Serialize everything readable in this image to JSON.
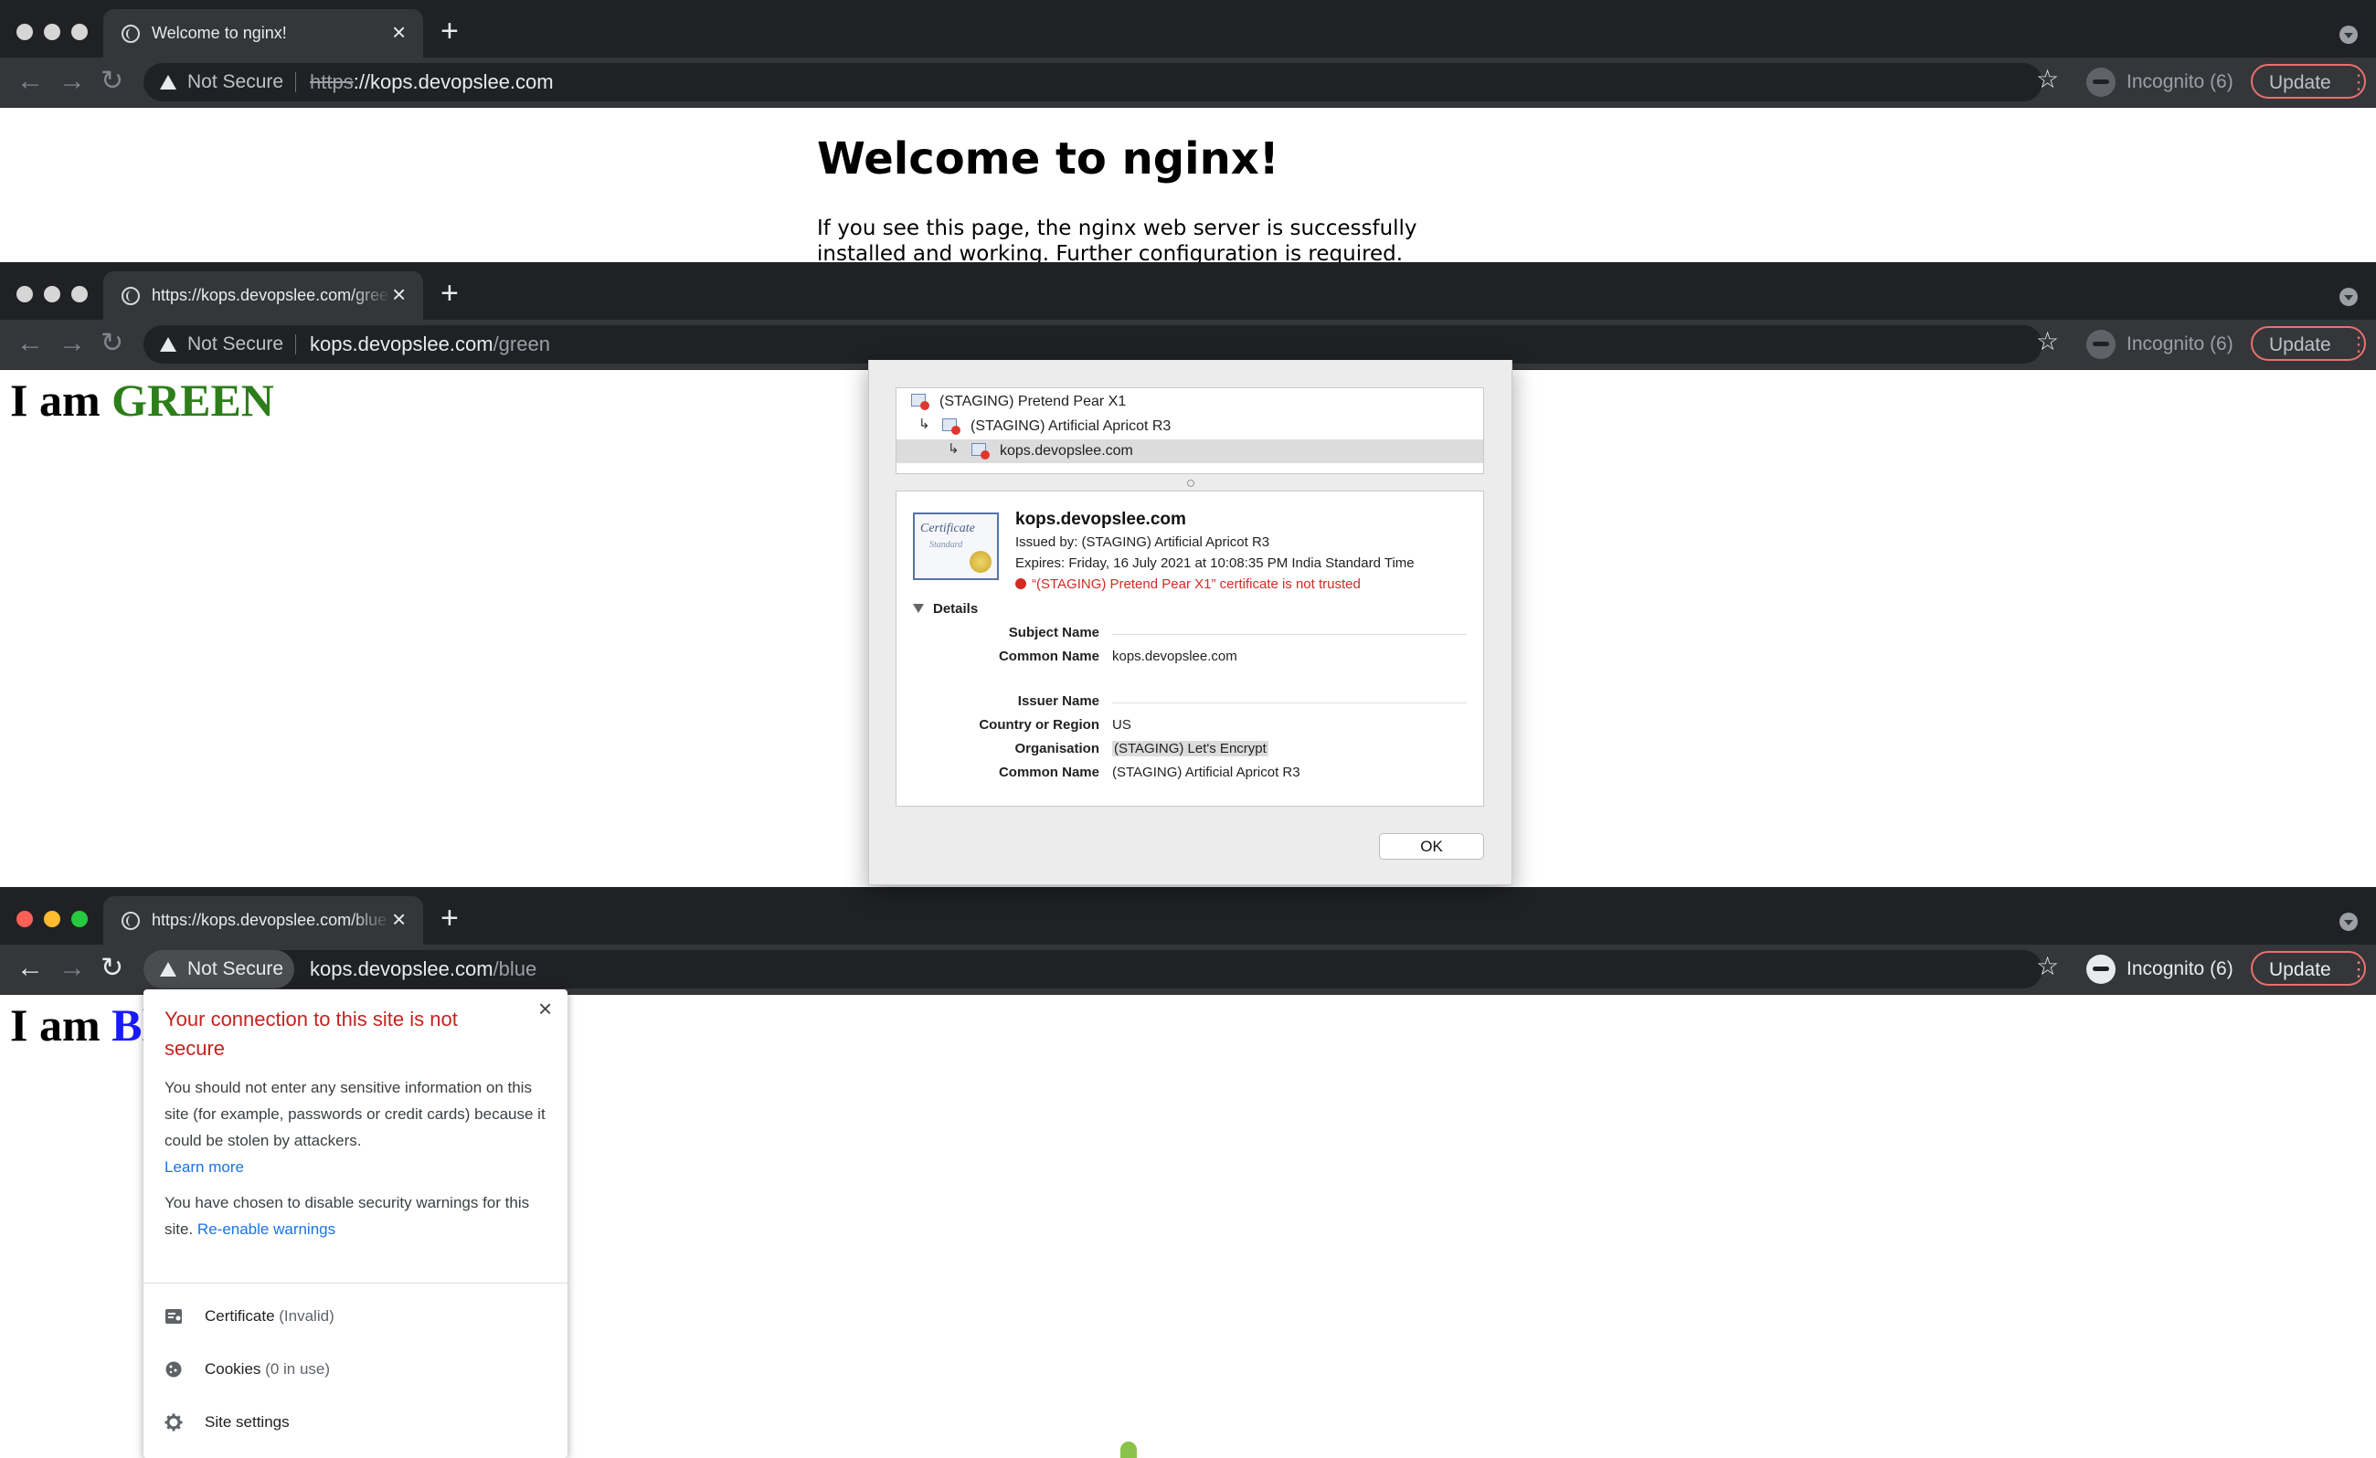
{
  "windows": [
    {
      "tab_title": "Welcome to nginx!",
      "not_secure": "Not Secure",
      "url_scheme": "https",
      "url_rest": "://kops.devopslee.com",
      "incognito": "Incognito (6)",
      "update": "Update"
    },
    {
      "tab_title": "https://kops.devopslee.com/green",
      "not_secure": "Not Secure",
      "url_host": "kops.devopslee.com",
      "url_path": "/green",
      "incognito": "Incognito (6)",
      "update": "Update"
    },
    {
      "tab_title": "https://kops.devopslee.com/blue",
      "not_secure": "Not Secure",
      "url_host": "kops.devopslee.com",
      "url_path": "/blue",
      "incognito": "Incognito (6)",
      "update": "Update"
    }
  ],
  "nginx": {
    "heading": "Welcome to nginx!",
    "paragraph": "If you see this page, the nginx web server is successfully installed and working. Further configuration is required."
  },
  "green_page": {
    "prefix": "I am ",
    "color_word": "GREEN"
  },
  "blue_page": {
    "prefix": "I am ",
    "color_word_visible": "Bl"
  },
  "cert_dialog": {
    "chain": [
      "(STAGING) Pretend Pear X1",
      "(STAGING) Artificial Apricot R3",
      "kops.devopslee.com"
    ],
    "cert_image_text": "Certificate",
    "cert_image_sub": "Standard",
    "name": "kops.devopslee.com",
    "issued_by": "Issued by: (STAGING) Artificial Apricot R3",
    "expires": "Expires: Friday, 16 July 2021 at 10:08:35 PM India Standard Time",
    "error": "“(STAGING) Pretend Pear X1” certificate is not trusted",
    "details_label": "Details",
    "subject_header": "Subject Name",
    "subject_cn_label": "Common Name",
    "subject_cn": "kops.devopslee.com",
    "issuer_header": "Issuer Name",
    "country_label": "Country or Region",
    "country": "US",
    "org_label": "Organisation",
    "org": "(STAGING) Let's Encrypt",
    "issuer_cn_label": "Common Name",
    "issuer_cn": "(STAGING) Artificial Apricot R3",
    "ok": "OK"
  },
  "security_popup": {
    "title": "Your connection to this site is not secure",
    "body": "You should not enter any sensitive information on this site (for example, passwords or credit cards) because it could be stolen by attackers.",
    "learn_more": "Learn more",
    "disabled_text": "You have chosen to disable security warnings for this site.",
    "reenable": "Re-enable warnings",
    "certificate": "Certificate",
    "certificate_status": "(Invalid)",
    "cookies": "Cookies",
    "cookies_status": "(0 in use)",
    "site_settings": "Site settings"
  },
  "icons": [
    "globe-icon",
    "close-icon",
    "plus-icon",
    "back-arrow-icon",
    "forward-arrow-icon",
    "reload-icon",
    "warning-triangle-icon",
    "star-icon",
    "incognito-icon",
    "more-vert-icon",
    "certificate-icon",
    "cookie-icon",
    "gear-icon",
    "certificate-error-icon",
    "disclosure-triangle-icon"
  ]
}
